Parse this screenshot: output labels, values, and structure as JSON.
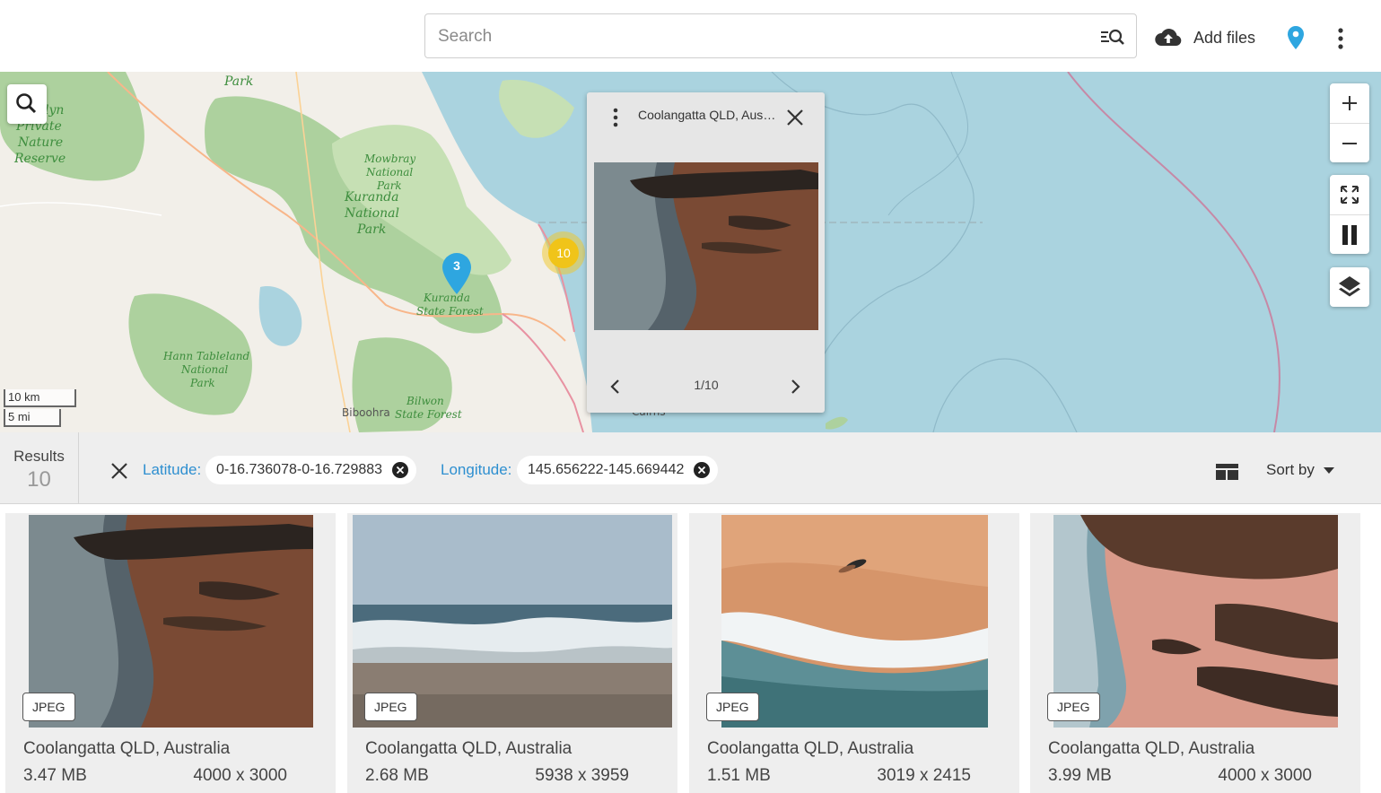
{
  "header": {
    "search_placeholder": "Search",
    "add_files_label": "Add files",
    "icons": [
      "search-filter-icon",
      "cloud-upload-icon",
      "location-pin-icon",
      "more-vertical-icon"
    ]
  },
  "map": {
    "labels": {
      "park_top": "Park",
      "lyn": "lyn",
      "private": "Private",
      "nature": "Nature",
      "reserve": "Reserve",
      "mowbray": "Mowbray",
      "national": "National",
      "park": "Park",
      "kuranda": "Kuranda",
      "national2": "National",
      "park2": "Park",
      "kuranda_sf": "Kuranda",
      "state_forest": "State Forest",
      "hann": "Hann Tableland",
      "national3": "National",
      "park3": "Park",
      "bilwon": "Bilwon",
      "biboohra": "Biboohra",
      "state_forest2": "State Forest",
      "cairns": "Cairns"
    },
    "scale_km": "10 km",
    "scale_mi": "5 mi",
    "marker_count": "3",
    "cluster_count": "10",
    "controls": [
      "zoom-in-icon",
      "zoom-out-icon",
      "fullscreen-icon",
      "pause-icon",
      "layers-icon"
    ],
    "colors": {
      "water": "#aad3df",
      "land": "#f2efe9",
      "forest": "#add19e",
      "marker": "#2ea6e0",
      "cluster": "#f0c419"
    }
  },
  "popup": {
    "title": "Coolangatta QLD, Australia",
    "counter": "1/10"
  },
  "filters": {
    "results_label": "Results",
    "results_count": "10",
    "latitude_label": "Latitude:",
    "latitude_value": "0-16.736078-0-16.729883",
    "longitude_label": "Longitude:",
    "longitude_value": "145.656222-145.669442",
    "sort_label": "Sort by"
  },
  "cards": [
    {
      "type": "JPEG",
      "title": "Coolangatta QLD, Australia",
      "size": "3.47 MB",
      "dims": "4000 x 3000"
    },
    {
      "type": "JPEG",
      "title": "Coolangatta QLD, Australia",
      "size": "2.68 MB",
      "dims": "5938 x 3959"
    },
    {
      "type": "JPEG",
      "title": "Coolangatta QLD, Australia",
      "size": "1.51 MB",
      "dims": "3019 x 2415"
    },
    {
      "type": "JPEG",
      "title": "Coolangatta QLD, Australia",
      "size": "3.99 MB",
      "dims": "4000 x 3000"
    }
  ]
}
